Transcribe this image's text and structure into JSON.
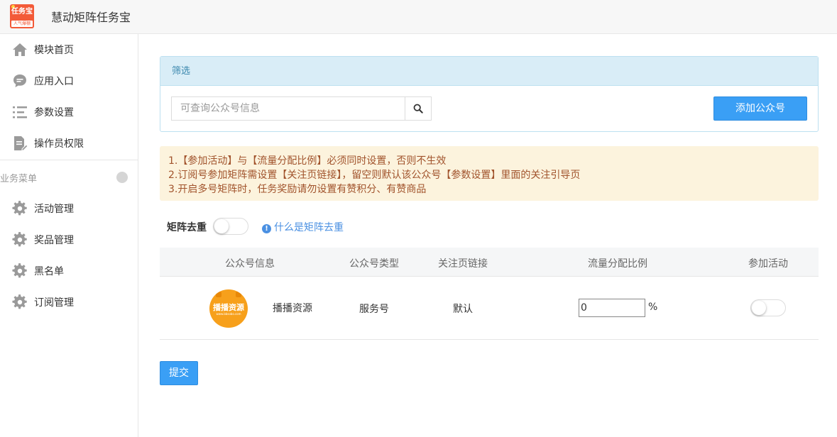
{
  "header": {
    "logo_text": "任务宝",
    "logo_subtext": "人气爆棚",
    "title": "慧动矩阵任务宝"
  },
  "sidebar": {
    "items": [
      {
        "label": "模块首页",
        "icon": "home-icon"
      },
      {
        "label": "应用入口",
        "icon": "chat-bubble-icon"
      },
      {
        "label": "参数设置",
        "icon": "list-settings-icon"
      },
      {
        "label": "操作员权限",
        "icon": "document-edit-icon"
      }
    ],
    "section_label": "业务菜单",
    "business_items": [
      {
        "label": "活动管理",
        "icon": "gear-icon"
      },
      {
        "label": "奖品管理",
        "icon": "gear-icon"
      },
      {
        "label": "黑名单",
        "icon": "gear-icon"
      },
      {
        "label": "订阅管理",
        "icon": "gear-icon"
      }
    ]
  },
  "filter": {
    "heading": "筛选",
    "search_placeholder": "可查询公众号信息",
    "search_value": "",
    "add_button": "添加公众号"
  },
  "notice": {
    "lines": [
      "1.【参加活动】与【流量分配比例】必须同时设置，否则不生效",
      "2.订阅号参加矩阵需设置【关注页链接】，留空则默认该公众号【参数设置】里面的关注引导页",
      "3.开启多号矩阵时，任务奖励请勿设置有赞积分、有赞商品"
    ]
  },
  "dedup": {
    "label": "矩阵去重",
    "enabled": false,
    "help_link": "什么是矩阵去重"
  },
  "table": {
    "headers": [
      "公众号信息",
      "公众号类型",
      "关注页链接",
      "流量分配比例",
      "参加活动"
    ],
    "rows": [
      {
        "avatar_text": "播播资源",
        "avatar_subtext": "www.bbsobo.com",
        "name": "播播资源",
        "type": "服务号",
        "follow_link": "默认",
        "ratio": "0",
        "ratio_unit": "%",
        "join_activity": false
      }
    ]
  },
  "submit_button": "提交",
  "colors": {
    "primary": "#3a9ff5",
    "filter_header_bg": "#d9edf7",
    "notice_bg": "#fcf3dd",
    "notice_text": "#a1532c",
    "link": "#4a90e2"
  }
}
